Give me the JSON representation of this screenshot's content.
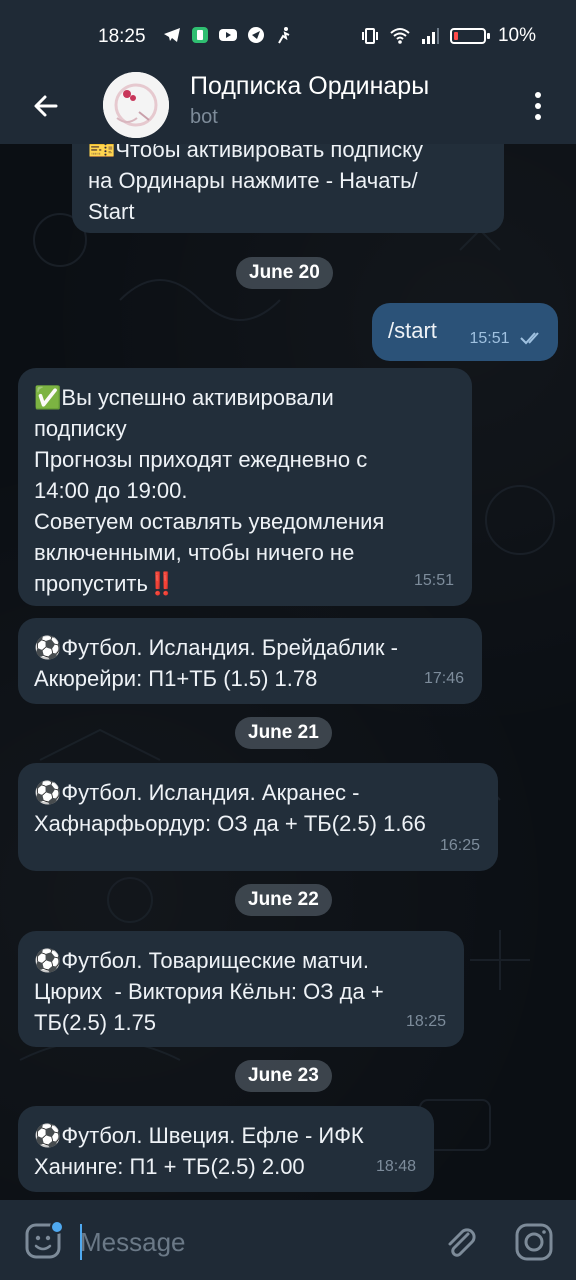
{
  "status_bar": {
    "time": "18:25",
    "battery_text": "10%"
  },
  "header": {
    "title": "Подписка Ординары",
    "subtitle": "bot",
    "back_icon": "arrow-left-icon",
    "menu_icon": "more-vertical-icon"
  },
  "messages": [
    {
      "id": "m0",
      "direction": "in",
      "text": "🎫Чтобы активировать подписку\nна Ординары нажмите - Начать/\nStart",
      "time": ""
    },
    {
      "id": "d1",
      "type": "date",
      "text": "June 20"
    },
    {
      "id": "m1",
      "direction": "out",
      "text": "/start",
      "time": "15:51",
      "read": true
    },
    {
      "id": "m2",
      "direction": "in",
      "text": "✅Вы успешно активировали\nподписку\nПрогнозы приходят ежедневно с\n14:00 до 19:00.\nСоветуем оставлять уведомления\nвключенными, чтобы ничего не\nпропустить‼️",
      "time": "15:51"
    },
    {
      "id": "m3",
      "direction": "in",
      "text": "⚽️Футбол. Исландия. Брейдаблик -\nАкюрейри: П1+ТБ (1.5) 1.78",
      "time": "17:46"
    },
    {
      "id": "d2",
      "type": "date",
      "text": "June 21"
    },
    {
      "id": "m4",
      "direction": "in",
      "text": "⚽️Футбол. Исландия. Акранес -\nХафнарфьордур: ОЗ да + ТБ(2.5) 1.66",
      "time": "16:25"
    },
    {
      "id": "d3",
      "type": "date",
      "text": "June 22"
    },
    {
      "id": "m5",
      "direction": "in",
      "text": "⚽️Футбол. Товарищеские матчи.\nЦюрих  - Виктория Кёльн: ОЗ да +\nТБ(2.5) 1.75",
      "time": "18:25"
    },
    {
      "id": "d4",
      "type": "date",
      "text": "June 23"
    },
    {
      "id": "m6",
      "direction": "in",
      "text": "⚽️Футбол. Швеция. Ефле - ИФК\nХанинге: П1 + ТБ(2.5) 2.00",
      "time": "18:48"
    }
  ],
  "input": {
    "placeholder": "Message",
    "value": ""
  },
  "colors": {
    "header_bg": "#1f2a36",
    "incoming_bubble": "#222e3a",
    "outgoing_bubble": "#2b5278",
    "accent": "#4fa9f0"
  }
}
